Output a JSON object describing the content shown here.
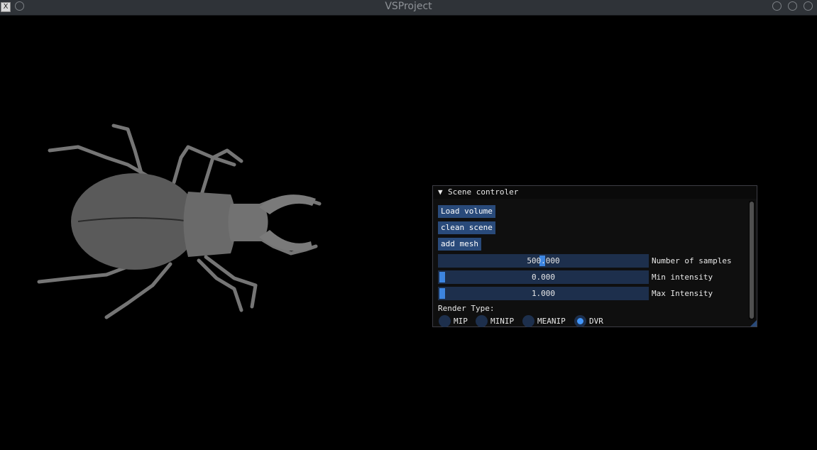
{
  "window": {
    "title": "VSProject",
    "app_icon_glyph": "X"
  },
  "panel": {
    "title": "Scene controler",
    "collapse_arrow": "▼",
    "buttons": {
      "load_volume": "Load volume",
      "clean_scene": "clean scene",
      "add_mesh": "add mesh"
    },
    "sliders": [
      {
        "label": "Number of samples",
        "value": "500.000",
        "fraction": 0.5
      },
      {
        "label": "Min intensity",
        "value": "0.000",
        "fraction": 0.0
      },
      {
        "label": "Max Intensity",
        "value": "1.000",
        "fraction": 0.0
      }
    ],
    "render_type_label": "Render Type:",
    "render_types": [
      {
        "label": "MIP",
        "selected": false
      },
      {
        "label": "MINIP",
        "selected": false
      },
      {
        "label": "MEANIP",
        "selected": false
      },
      {
        "label": "DVR",
        "selected": true
      }
    ]
  },
  "colors": {
    "accent": "#4296fa",
    "button_bg": "#294a7a",
    "frame_bg": "#1d2f4c",
    "titlebar": "#2f3338"
  },
  "icons": {
    "app": "x11-app-icon",
    "window_controls": [
      "minimize-icon",
      "maximize-icon",
      "close-icon"
    ]
  }
}
